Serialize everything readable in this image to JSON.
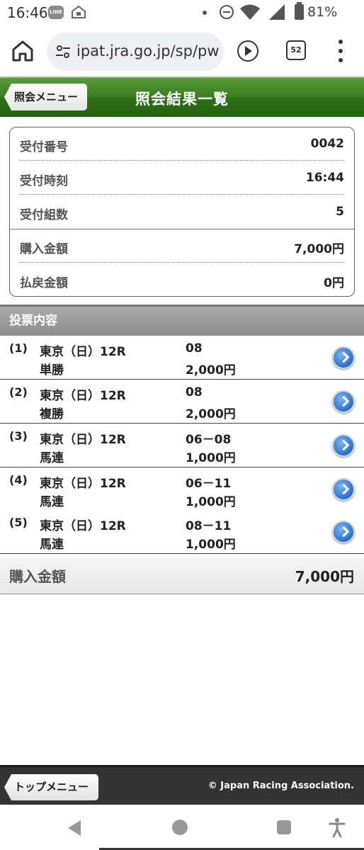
{
  "status_bar": {
    "time": "16:46",
    "line_icon_text": "LINE",
    "battery": "81%"
  },
  "browser": {
    "url": "ipat.jra.go.jp/sp/pw",
    "tab_count": "52"
  },
  "header": {
    "back_label": "照会メニュー",
    "title": "照会結果一覧"
  },
  "summary": {
    "rows": [
      {
        "label": "受付番号",
        "value": "0042"
      },
      {
        "label": "受付時刻",
        "value": "16:44"
      },
      {
        "label": "受付組数",
        "value": "5"
      },
      {
        "label": "購入金額",
        "value": "7,000円"
      },
      {
        "label": "払戻金額",
        "value": "0円"
      }
    ]
  },
  "votes": {
    "heading": "投票内容",
    "items": [
      {
        "num": "(1)",
        "race": "東京（日）12R",
        "type": "単勝",
        "combo": "08",
        "amount": "2,000円"
      },
      {
        "num": "(2)",
        "race": "東京（日）12R",
        "type": "複勝",
        "combo": "08",
        "amount": "2,000円"
      },
      {
        "num": "(3)",
        "race": "東京（日）12R",
        "type": "馬連",
        "combo": "06－08",
        "amount": "1,000円"
      },
      {
        "num": "(4)",
        "race": "東京（日）12R",
        "type": "馬連",
        "combo": "06－11",
        "amount": "1,000円"
      },
      {
        "num": "(5)",
        "race": "東京（日）12R",
        "type": "馬連",
        "combo": "08－11",
        "amount": "1,000円"
      }
    ],
    "total_label": "購入金額",
    "total_value": "7,000円"
  },
  "footer": {
    "top_menu_label": "トップメニュー",
    "copyright": "© Japan Racing Association."
  }
}
